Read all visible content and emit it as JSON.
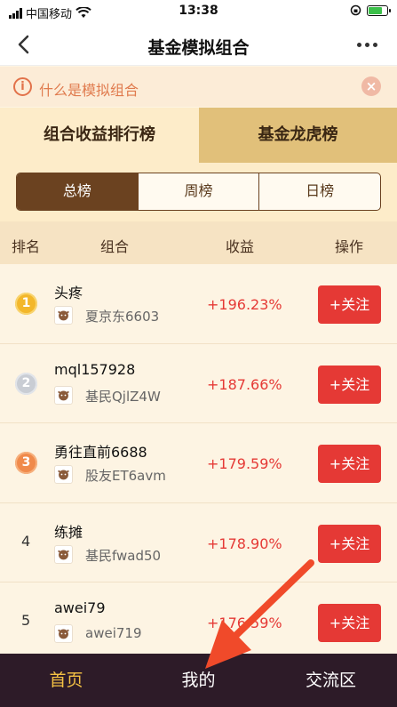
{
  "status_bar": {
    "carrier": "中国移动",
    "time": "13:38"
  },
  "nav": {
    "title": "基金模拟组合"
  },
  "info": {
    "text": "什么是模拟组合",
    "icon_glyph": "i",
    "close_glyph": "×"
  },
  "main_tabs": [
    {
      "label": "组合收益排行榜",
      "active": true
    },
    {
      "label": "基金龙虎榜",
      "active": false
    }
  ],
  "sub_tabs": [
    {
      "label": "总榜",
      "active": true
    },
    {
      "label": "周榜",
      "active": false
    },
    {
      "label": "日榜",
      "active": false
    }
  ],
  "table_header": {
    "rank": "排名",
    "portfolio": "组合",
    "gain": "收益",
    "action": "操作"
  },
  "rows": [
    {
      "rank": "1",
      "medal": "gold",
      "name": "头疼",
      "owner": "夏京东6603",
      "gain": "+196.23%",
      "button": "+关注"
    },
    {
      "rank": "2",
      "medal": "silver",
      "name": "mql157928",
      "owner": "基民QjlZ4W",
      "gain": "+187.66%",
      "button": "+关注"
    },
    {
      "rank": "3",
      "medal": "bronze",
      "name": "勇往直前6688",
      "owner": "股友ET6avm",
      "gain": "+179.59%",
      "button": "+关注"
    },
    {
      "rank": "4",
      "medal": "none",
      "name": "练摊",
      "owner": "基民fwad50",
      "gain": "+178.90%",
      "button": "+关注"
    },
    {
      "rank": "5",
      "medal": "none",
      "name": "awei79",
      "owner": "awei719",
      "gain": "+176.59%",
      "button": "+关注"
    }
  ],
  "bottom_nav": [
    {
      "label": "首页",
      "active": true
    },
    {
      "label": "我的",
      "active": false
    },
    {
      "label": "交流区",
      "active": false
    }
  ],
  "colors": {
    "accent_red": "#e53935",
    "brand_brown": "#6b4220",
    "bottom_bar": "#2d1b28",
    "active_gold": "#f5c244",
    "arrow": "#f04a2a"
  },
  "icons": {
    "back": "chevron-left-icon",
    "more": "more-dots-icon",
    "info": "info-circle-icon",
    "close": "close-icon",
    "wifi": "wifi-icon",
    "battery": "battery-icon",
    "lock": "rotation-lock-icon"
  }
}
